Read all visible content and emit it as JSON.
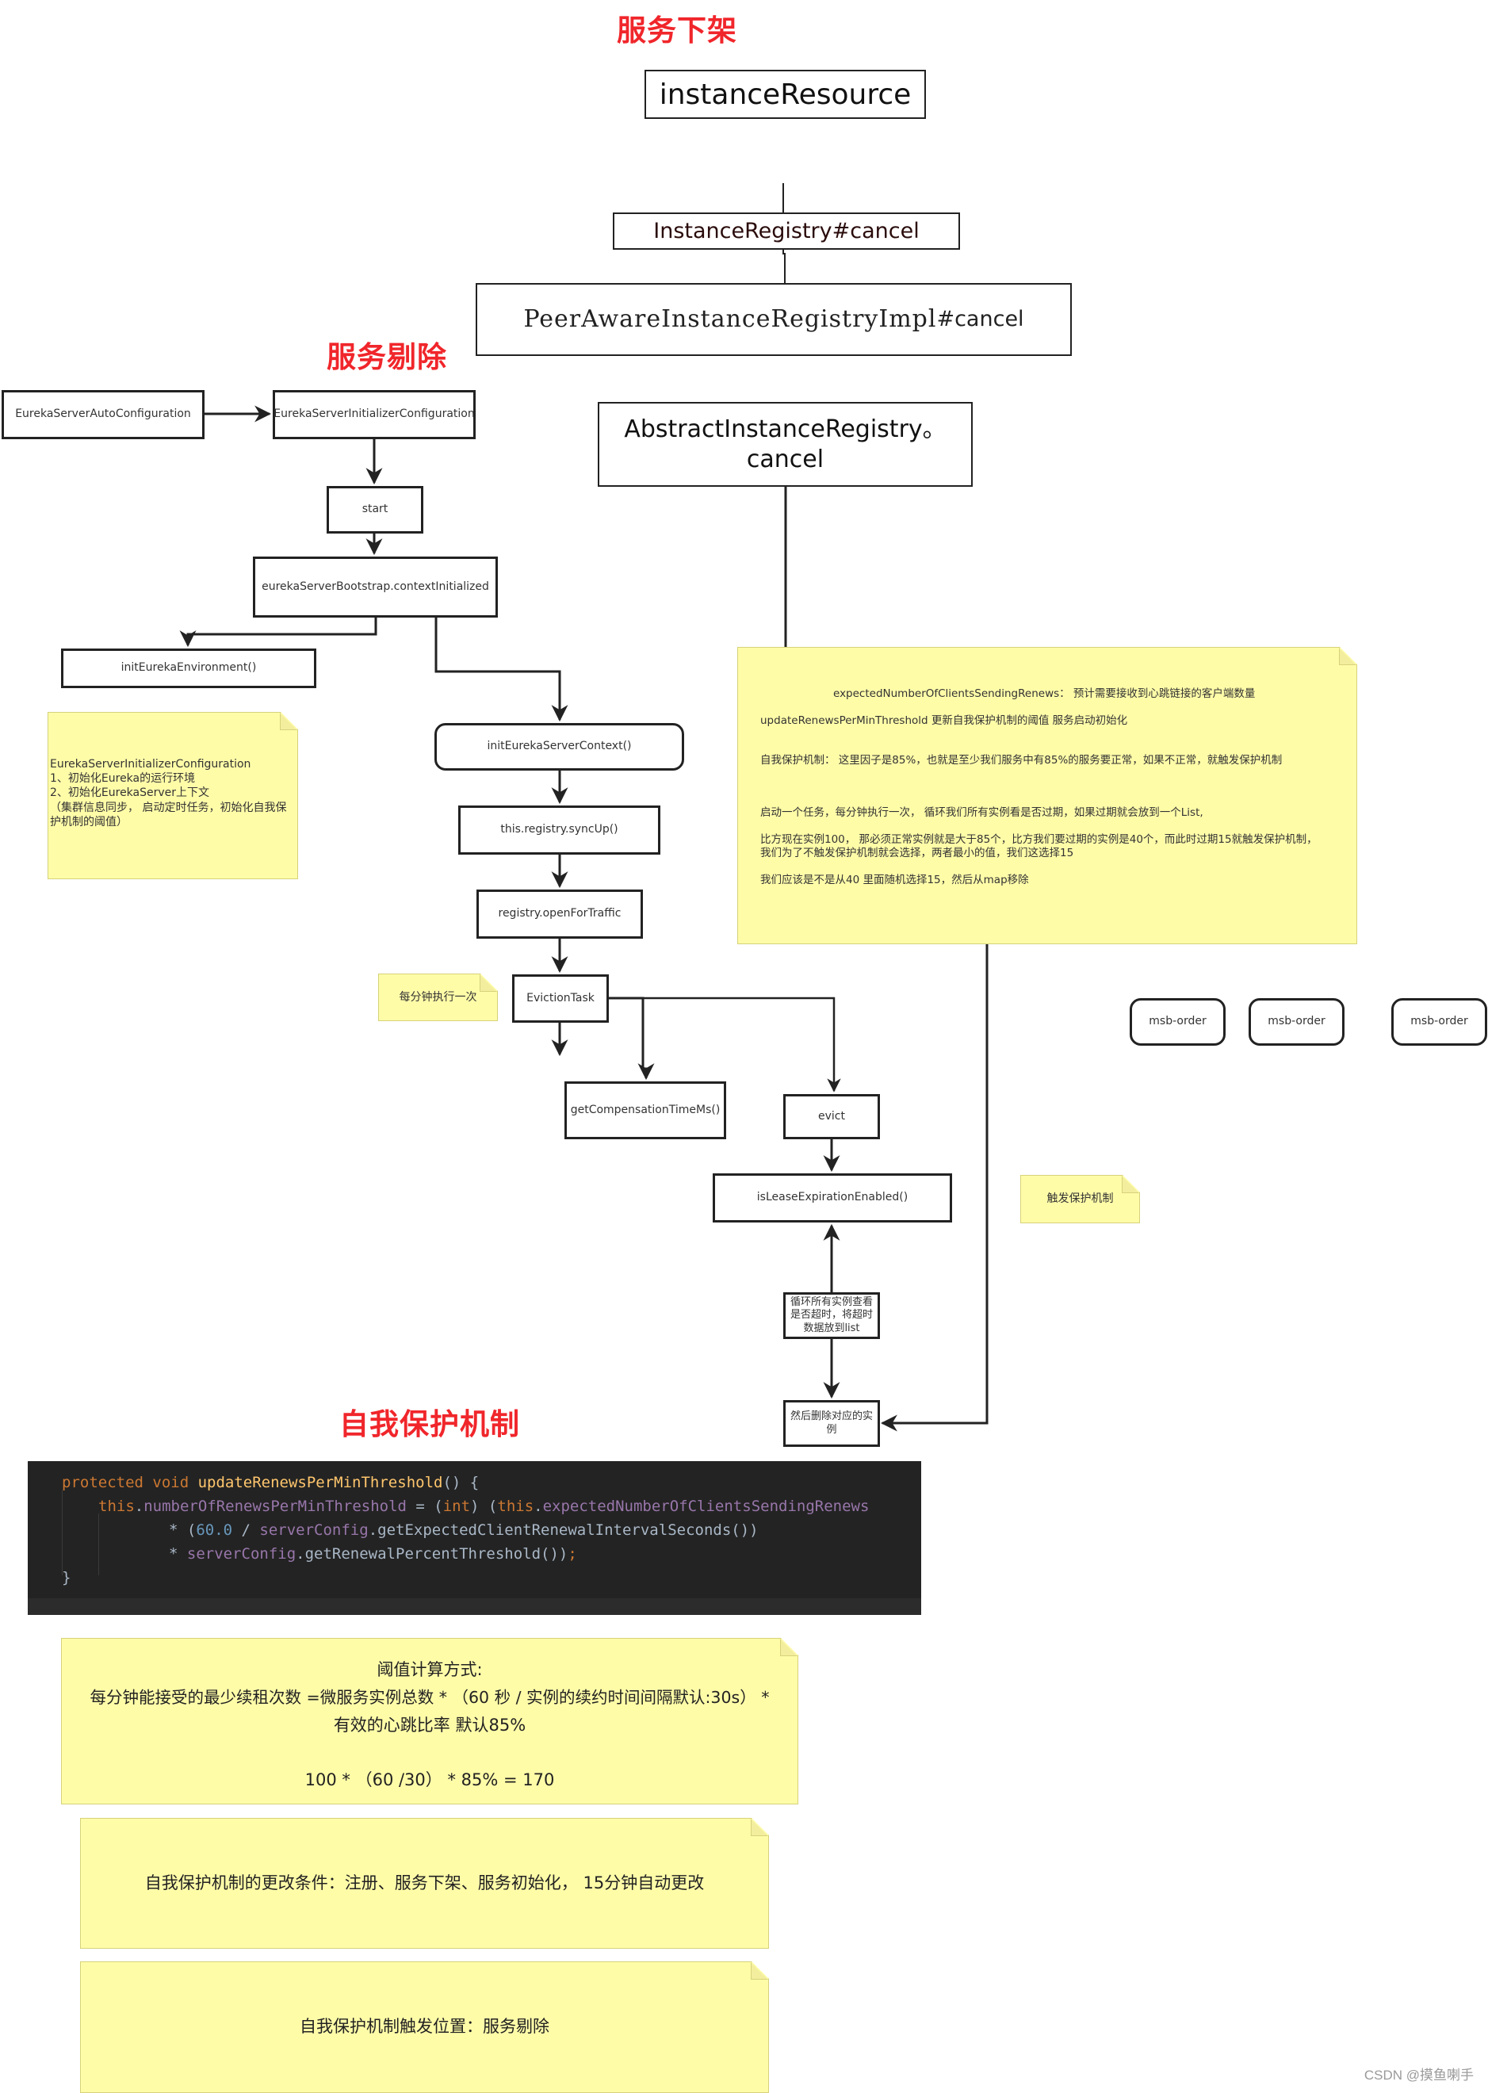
{
  "sections": {
    "service_offline": "服务下架",
    "service_eviction": "服务剔除",
    "self_protection": "自我保护机制"
  },
  "offline_flow": {
    "instance_resource": "instanceResource",
    "instance_registry_cancel": "InstanceRegistry#cancel",
    "peer_aware_cancel_prefix": "PeerAwareInstanceRegistryImpl",
    "peer_aware_cancel_suffix": "#cancel",
    "abstract_cancel": "AbstractInstanceRegistry。cancel"
  },
  "eviction_flow": {
    "auto_config": "EurekaServerAutoConfiguration",
    "initializer_config": "EurekaServerInitializerConfiguration",
    "start": "start",
    "context_initialized": "eurekaServerBootstrap.contextInitialized",
    "init_environment": "initEurekaEnvironment()",
    "init_server_context": "initEurekaServerContext()",
    "sync_up": "this.registry.syncUp()",
    "open_for_traffic": "registry.openForTraffic",
    "eviction_task": "EvictionTask",
    "get_compensation": "getCompensationTimeMs()",
    "evict": "evict",
    "is_lease_expiration": "isLeaseExpirationEnabled()",
    "loop_instances": "循环所有实例查看是否超时，将超时数据放到list",
    "delete_instance": "然后删除对应的实例"
  },
  "notes": {
    "initializer_note": [
      "EurekaServerInitializerConfiguration",
      "1、初始化Eureka的运行环境",
      "2、初始化EurekaServer上下文",
      "（集群信息同步， 启动定时任务，初始化自我保护机制的阈值）"
    ],
    "per_minute": "每分钟执行一次",
    "trigger_protection": "触发保护机制",
    "big_note": {
      "expected_clients": "expectedNumberOfClientsSendingRenews：  预计需要接收到心跳链接的客户端数量",
      "update_threshold": "updateRenewsPerMinThreshold 更新自我保护机制的阈值  服务启动初始化",
      "self_protection": "自我保护机制：  这里因子是85%，也就是至少我们服务中有85%的服务要正常，如果不正常，就触发保护机制",
      "task": "启动一个任务，每分钟执行一次，  循环我们所有实例看是否过期，如果过期就会放到一个List,",
      "example_1": "比方现在实例100，  那必须正常实例就是大于85个，比方我们要过期的实例是40个，而此时过期15就触发保护机制，",
      "example_2": "我们为了不触发保护机制就会选择，两者最小的值，我们这选择15",
      "question": "我们应该是不是从40 里面随机选择15，然后从map移除"
    },
    "threshold_note": {
      "title": "阈值计算方式:",
      "formula": "每分钟能接受的最少续租次数 =微服务实例总数 *  （60 秒 / 实例的续约时间间隔默认:30s） *",
      "formula_tail": "有效的心跳比率 默认85%",
      "example": "100 *  （60 /30）  * 85% = 170"
    },
    "change_conditions": "自我保护机制的更改条件：注册、服务下架、服务初始化，  15分钟自动更改",
    "trigger_location": "自我保护机制触发位置：服务剔除"
  },
  "instances": [
    "msb-order",
    "msb-order",
    "msb-order"
  ],
  "code": {
    "l1_kw": "protected void ",
    "l1_fn": "updateRenewsPerMinThreshold",
    "l1_rest": "() {",
    "l2_this": "this",
    "l2_dot": ".",
    "l2_field": "numberOfRenewsPerMinThreshold",
    "l2_eq": " = (",
    "l2_int": "int",
    "l2_paren": ") (",
    "l2_this2": "this",
    "l2_dot2": ".",
    "l2_field2": "expectedNumberOfClientsSendingRenews",
    "l3_star": "* (",
    "l3_num": "60.0",
    "l3_div": " / ",
    "l3_field": "serverConfig",
    "l3_call": ".getExpectedClientRenewalIntervalSeconds())",
    "l4_star": "* ",
    "l4_field": "serverConfig",
    "l4_call": ".getRenewalPercentThreshold())",
    "l4_semi": ";",
    "l5": "}"
  },
  "watermark": "CSDN @摸鱼喇手"
}
